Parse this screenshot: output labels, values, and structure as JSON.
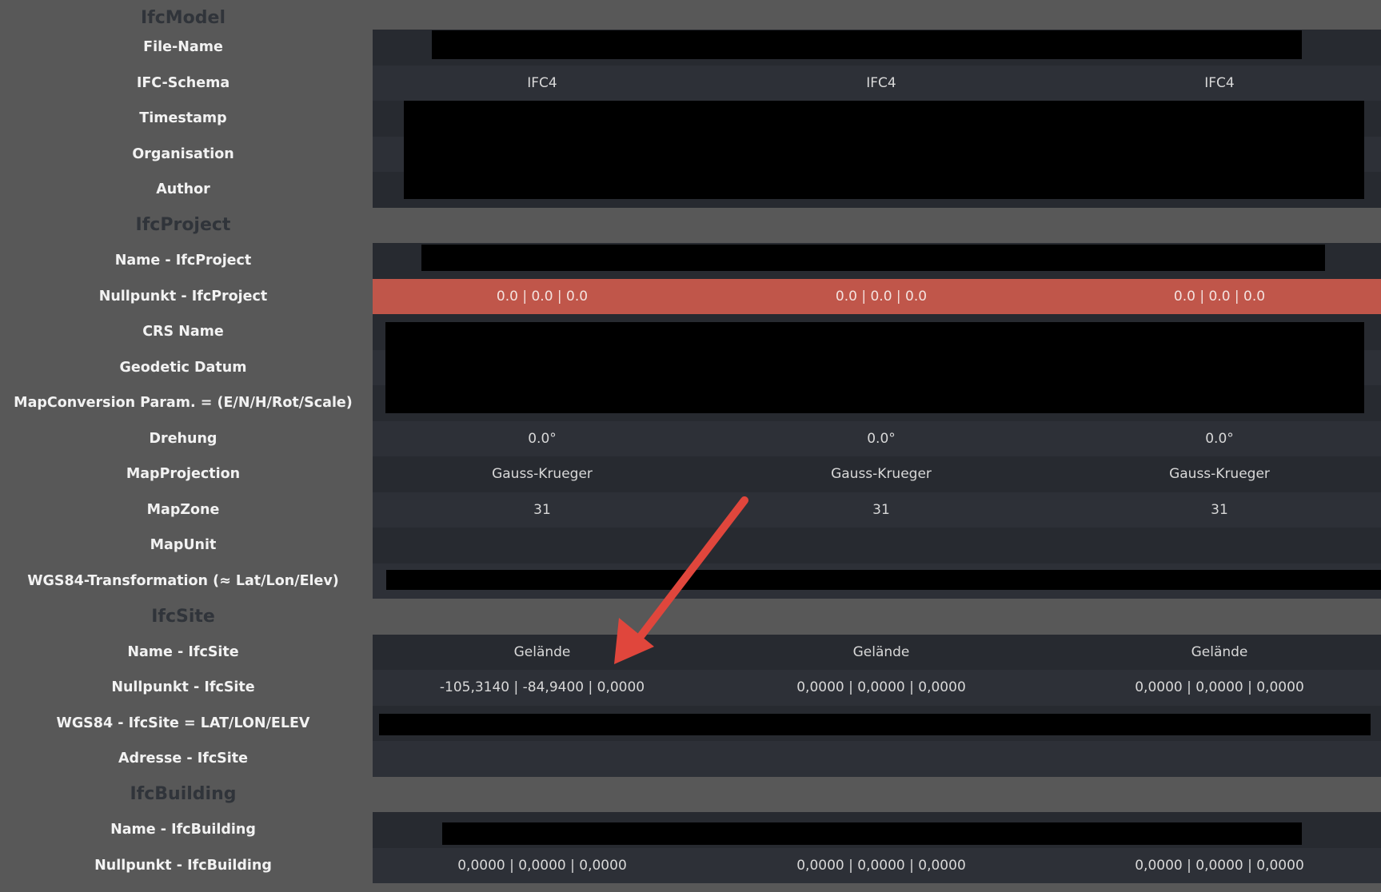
{
  "sections": {
    "ifcmodel": "IfcModel",
    "ifcproject": "IfcProject",
    "ifcsite": "IfcSite",
    "ifcbuilding": "IfcBuilding"
  },
  "rows": {
    "file_name": {
      "label": "File-Name"
    },
    "ifc_schema": {
      "label": "IFC-Schema",
      "values": [
        "IFC4",
        "IFC4",
        "IFC4"
      ]
    },
    "timestamp": {
      "label": "Timestamp"
    },
    "organisation": {
      "label": "Organisation"
    },
    "author": {
      "label": "Author"
    },
    "name_ifcproject": {
      "label": "Name - IfcProject"
    },
    "nullpunkt_ifcproject": {
      "label": "Nullpunkt - IfcProject",
      "values": [
        "0.0 | 0.0 | 0.0",
        "0.0 | 0.0 | 0.0",
        "0.0 | 0.0 | 0.0"
      ]
    },
    "crs_name": {
      "label": "CRS Name"
    },
    "geodetic_datum": {
      "label": "Geodetic Datum"
    },
    "mapconversion": {
      "label": "MapConversion Param. = (E/N/H/Rot/Scale)"
    },
    "drehung": {
      "label": "Drehung",
      "values": [
        "0.0°",
        "0.0°",
        "0.0°"
      ]
    },
    "mapprojection": {
      "label": "MapProjection",
      "values": [
        "Gauss-Krueger",
        "Gauss-Krueger",
        "Gauss-Krueger"
      ]
    },
    "mapzone": {
      "label": "MapZone",
      "values": [
        "31",
        "31",
        "31"
      ]
    },
    "mapunit": {
      "label": "MapUnit"
    },
    "wgs84_transformation": {
      "label": "WGS84-Transformation (≈ Lat/Lon/Elev)"
    },
    "name_ifcsite": {
      "label": "Name - IfcSite",
      "values": [
        "Gelände",
        "Gelände",
        "Gelände"
      ]
    },
    "nullpunkt_ifcsite": {
      "label": "Nullpunkt - IfcSite",
      "values": [
        "-105,3140 | -84,9400 | 0,0000",
        "0,0000 | 0,0000 | 0,0000",
        "0,0000 | 0,0000 | 0,0000"
      ]
    },
    "wgs84_ifcsite": {
      "label": "WGS84 - IfcSite = LAT/LON/ELEV"
    },
    "adresse_ifcsite": {
      "label": "Adresse - IfcSite"
    },
    "name_ifcbuilding": {
      "label": "Name - IfcBuilding"
    },
    "nullpunkt_ifcbuilding": {
      "label": "Nullpunkt - IfcBuilding",
      "values": [
        "0,0000 | 0,0000 | 0,0000",
        "0,0000 | 0,0000 | 0,0000",
        "0,0000 | 0,0000 | 0,0000"
      ]
    }
  },
  "colors": {
    "background": "#585858",
    "row_dark": "#272a30",
    "row_alt": "#2d3037",
    "alert_row": "#c0564a",
    "annotation_arrow": "#e0463c",
    "redaction": "#000000"
  },
  "annotation": {
    "icon": "arrow-annotation-icon"
  }
}
